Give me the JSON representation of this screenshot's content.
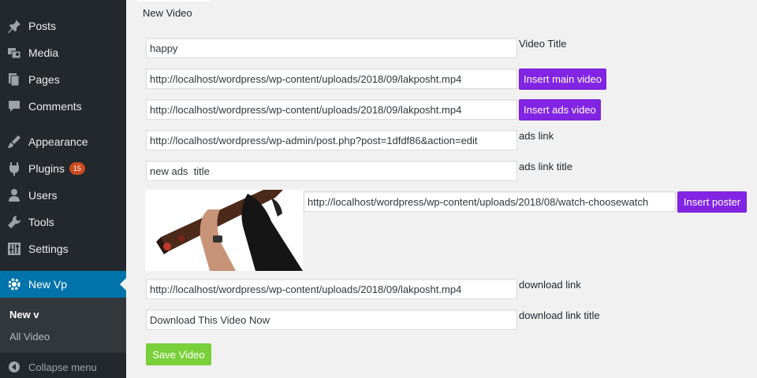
{
  "sidebar": {
    "items": [
      {
        "label": "Posts",
        "icon": "pin-icon"
      },
      {
        "label": "Media",
        "icon": "media-icon"
      },
      {
        "label": "Pages",
        "icon": "pages-icon"
      },
      {
        "label": "Comments",
        "icon": "comments-icon"
      },
      {
        "label": "Appearance",
        "icon": "appearance-icon"
      },
      {
        "label": "Plugins",
        "icon": "plugins-icon",
        "badge": "15"
      },
      {
        "label": "Users",
        "icon": "users-icon"
      },
      {
        "label": "Tools",
        "icon": "tools-icon"
      },
      {
        "label": "Settings",
        "icon": "settings-icon"
      },
      {
        "label": "New Vp",
        "icon": "gear-icon",
        "active": true
      }
    ],
    "submenu": [
      {
        "label": "New v",
        "current": true
      },
      {
        "label": "All Video"
      }
    ],
    "collapse_label": "Collapse menu"
  },
  "main": {
    "tab_label": "New Video",
    "title_value": "happy",
    "title_label": "Video Title",
    "main_video_value": "http://localhost/wordpress/wp-content/uploads/2018/09/lakposht.mp4",
    "insert_main_label": "Insert main video",
    "ads_video_value": "http://localhost/wordpress/wp-content/uploads/2018/09/lakposht.mp4",
    "insert_ads_label": "Insert ads video",
    "ads_link_value": "http://localhost/wordpress/wp-admin/post.php?post=1dfdf86&action=edit",
    "ads_link_label": "ads link",
    "ads_link_title_value": "new ads  title",
    "ads_link_title_label": "ads link title",
    "poster_value": "http://localhost/wordpress/wp-content/uploads/2018/08/watch-choosewatch",
    "insert_poster_label": "Insert poster",
    "download_link_value": "http://localhost/wordpress/wp-content/uploads/2018/09/lakposht.mp4",
    "download_link_label": "download link",
    "download_title_value": "Download This Video Now",
    "download_title_label": "download link title",
    "save_label": "Save Video"
  },
  "colors": {
    "sidebar_bg": "#23282d",
    "active": "#0073aa",
    "purple": "#8224e3",
    "green": "#7ad03a"
  }
}
